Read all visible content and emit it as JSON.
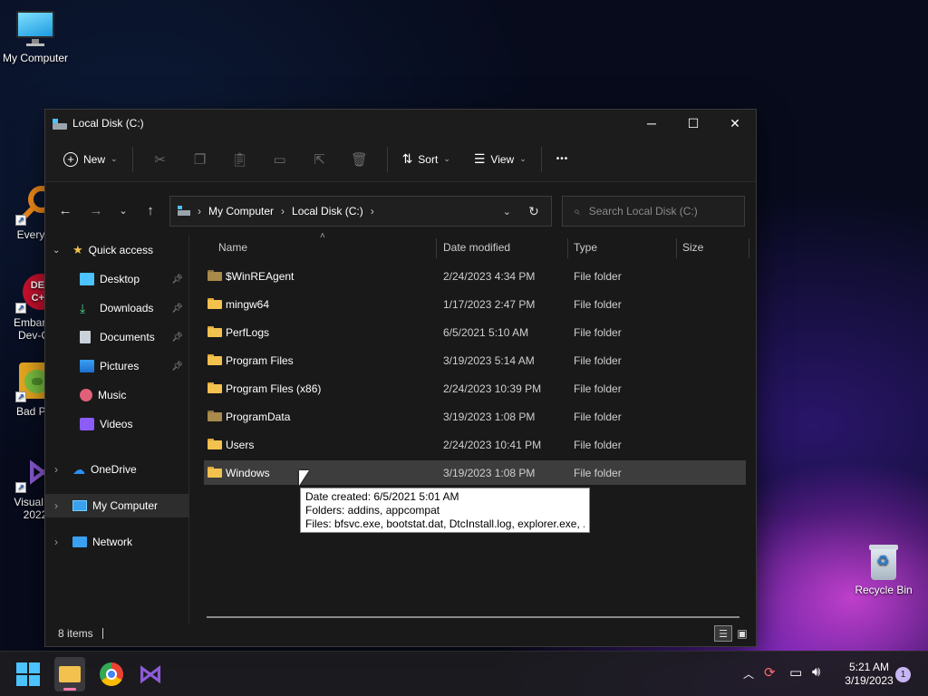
{
  "desktop": {
    "icons": [
      {
        "label": "My Computer",
        "icon": "monitor-icon"
      },
      {
        "label": "Everyth",
        "icon": "everything-search-icon"
      },
      {
        "label": "Embarca",
        "label2": "Dev-C-",
        "icon": "dev-cpp-icon"
      },
      {
        "label": "Bad Pig",
        "icon": "bad-piggies-icon"
      },
      {
        "label": "Visual St",
        "label2": "2022",
        "icon": "visual-studio-icon"
      },
      {
        "label": "Recycle Bin",
        "icon": "recycle-bin-icon"
      }
    ]
  },
  "window": {
    "title": "Local Disk (C:)",
    "controls": {
      "minimize": "─",
      "maximize": "☐",
      "close": "✕"
    },
    "toolbar": {
      "new_label": "New",
      "sort_label": "Sort",
      "view_label": "View",
      "more_label": "•••"
    },
    "address": {
      "segments": [
        "My Computer",
        "Local Disk (C:)"
      ]
    },
    "search": {
      "placeholder": "Search Local Disk (C:)"
    },
    "sidebar": {
      "quick_access": "Quick access",
      "items": [
        {
          "label": "Desktop",
          "pinned": true
        },
        {
          "label": "Downloads",
          "pinned": true
        },
        {
          "label": "Documents",
          "pinned": true
        },
        {
          "label": "Pictures",
          "pinned": true
        },
        {
          "label": "Music",
          "pinned": false
        },
        {
          "label": "Videos",
          "pinned": false
        }
      ],
      "onedrive": "OneDrive",
      "mycomputer": "My Computer",
      "network": "Network"
    },
    "columns": {
      "name": "Name",
      "date": "Date modified",
      "type": "Type",
      "size": "Size"
    },
    "files": [
      {
        "name": "$WinREAgent",
        "date": "2/24/2023 4:34 PM",
        "type": "File folder",
        "hidden": true
      },
      {
        "name": "mingw64",
        "date": "1/17/2023 2:47 PM",
        "type": "File folder",
        "hidden": false
      },
      {
        "name": "PerfLogs",
        "date": "6/5/2021 5:10 AM",
        "type": "File folder",
        "hidden": false
      },
      {
        "name": "Program Files",
        "date": "3/19/2023 5:14 AM",
        "type": "File folder",
        "hidden": false
      },
      {
        "name": "Program Files (x86)",
        "date": "2/24/2023 10:39 PM",
        "type": "File folder",
        "hidden": false
      },
      {
        "name": "ProgramData",
        "date": "3/19/2023 1:08 PM",
        "type": "File folder",
        "hidden": true
      },
      {
        "name": "Users",
        "date": "2/24/2023 10:41 PM",
        "type": "File folder",
        "hidden": false
      },
      {
        "name": "Windows",
        "date": "3/19/2023 1:08 PM",
        "type": "File folder",
        "hidden": false
      }
    ],
    "tooltip": {
      "line1": "Date created: 6/5/2021 5:01 AM",
      "line2": "Folders: addins, appcompat",
      "line3": "Files: bfsvc.exe, bootstat.dat, DtcInstall.log, explorer.exe, ..."
    },
    "status": {
      "count": "8 items"
    }
  },
  "taskbar": {
    "time": "5:21 AM",
    "date": "3/19/2023",
    "notification_count": "1"
  },
  "colors": {
    "accent": "#4cc2ff",
    "folder": "#f2c14e",
    "window_bg": "#191919"
  }
}
